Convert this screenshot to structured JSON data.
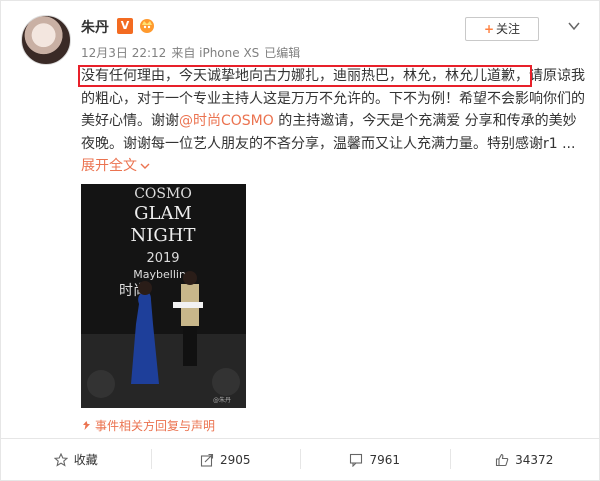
{
  "post": {
    "author": "朱丹",
    "verified_badge": "V",
    "time": "12月3日 22:12",
    "source": "来自 iPhone XS",
    "edited": "已编辑",
    "follow_label": "关注",
    "text_highlighted": "没有任何理由，今天诚挚地向古力娜扎，迪丽热巴，林允，林允儿道歉，",
    "text_1": "请原谅我的粗心，对于一个专业主持人这是万万不允许的。下不为例！希望不会影响你们的美好心情。谢谢",
    "mention": "@时尚COSMO",
    "text_2": " 的主持邀请，今天是个充满爱 分享和传承的美妙夜晚。谢谢每一位艺人朋友的不吝分享，温馨而又让人充满力量。特别感谢r1 ...",
    "expand_label": "展开全文",
    "expand_icon": "chevron-down",
    "photo": {
      "poster_lines": [
        "COSMO",
        "GLAM",
        "NIGHT",
        "2019",
        "Maybelline",
        "时尚"
      ],
      "watermark": "@朱丹"
    },
    "statement": "事件相关方回复与声明",
    "highlight_color": "#e8202a",
    "link_color": "#eb7350"
  },
  "actions": [
    {
      "icon": "star-icon",
      "label": "收藏"
    },
    {
      "icon": "share-icon",
      "label": "2905"
    },
    {
      "icon": "comment-icon",
      "label": "7961"
    },
    {
      "icon": "like-icon",
      "label": "34372"
    }
  ]
}
